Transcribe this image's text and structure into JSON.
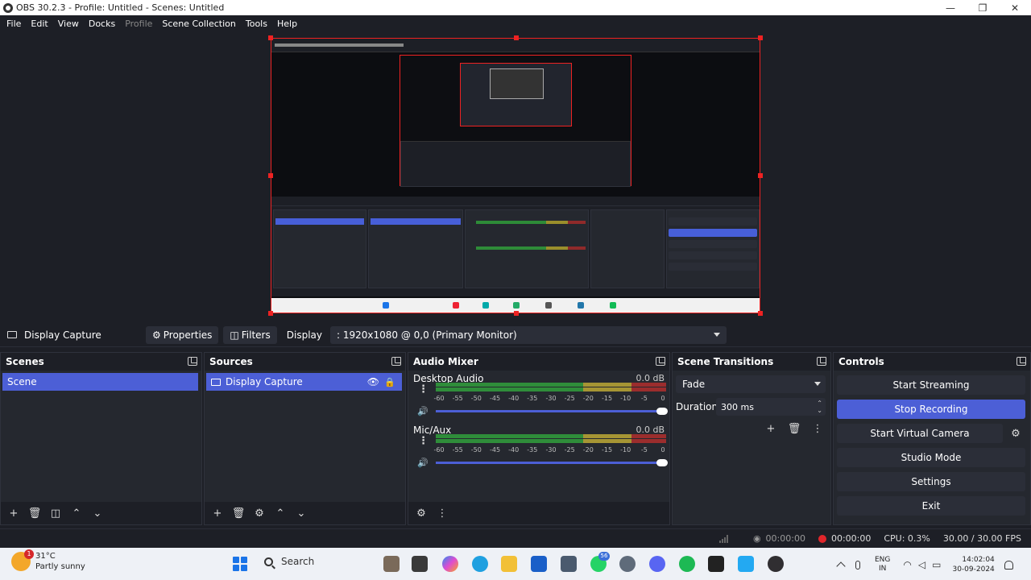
{
  "window": {
    "title": "OBS 30.2.3 - Profile: Untitled - Scenes: Untitled",
    "minimize": "—",
    "maximize": "❐",
    "close": "✕"
  },
  "menu": [
    "File",
    "Edit",
    "View",
    "Docks",
    "Profile",
    "Scene Collection",
    "Tools",
    "Help"
  ],
  "source_toolbar": {
    "source_name": "Display Capture",
    "properties_label": "Properties",
    "filters_label": "Filters",
    "display_label": "Display",
    "display_value": ": 1920x1080 @ 0,0 (Primary Monitor)"
  },
  "scenes": {
    "title": "Scenes",
    "items": [
      "Scene"
    ]
  },
  "sources": {
    "title": "Sources",
    "items": [
      "Display Capture"
    ]
  },
  "audio_mixer": {
    "title": "Audio Mixer",
    "channels": [
      {
        "name": "Desktop Audio",
        "db": "0.0 dB",
        "volume": 1.0
      },
      {
        "name": "Mic/Aux",
        "db": "0.0 dB",
        "volume": 1.0
      }
    ],
    "ticks": [
      "-60",
      "-55",
      "-50",
      "-45",
      "-40",
      "-35",
      "-30",
      "-25",
      "-20",
      "-15",
      "-10",
      "-5",
      "0"
    ]
  },
  "scene_transitions": {
    "title": "Scene Transitions",
    "transition": "Fade",
    "duration_label": "Duration",
    "duration_value": "300 ms"
  },
  "controls": {
    "title": "Controls",
    "start_streaming": "Start Streaming",
    "stop_recording": "Stop Recording",
    "start_virtual_camera": "Start Virtual Camera",
    "studio_mode": "Studio Mode",
    "settings": "Settings",
    "exit": "Exit"
  },
  "status": {
    "stream_time": "00:00:00",
    "rec_time": "00:00:00",
    "cpu": "CPU: 0.3%",
    "fps": "30.00 / 30.00 FPS"
  },
  "taskbar": {
    "temp": "31°C",
    "weather": "Partly sunny",
    "weather_badge": "1",
    "search": "Search",
    "whatsapp_badge": "56",
    "lang_1": "ENG",
    "lang_2": "IN",
    "time": "14:02:04",
    "date": "30-09-2024"
  },
  "colors": {
    "accent": "#4c5fd6",
    "record": "#e0252a",
    "bg": "#1d1f26",
    "panel": "#25282f"
  }
}
